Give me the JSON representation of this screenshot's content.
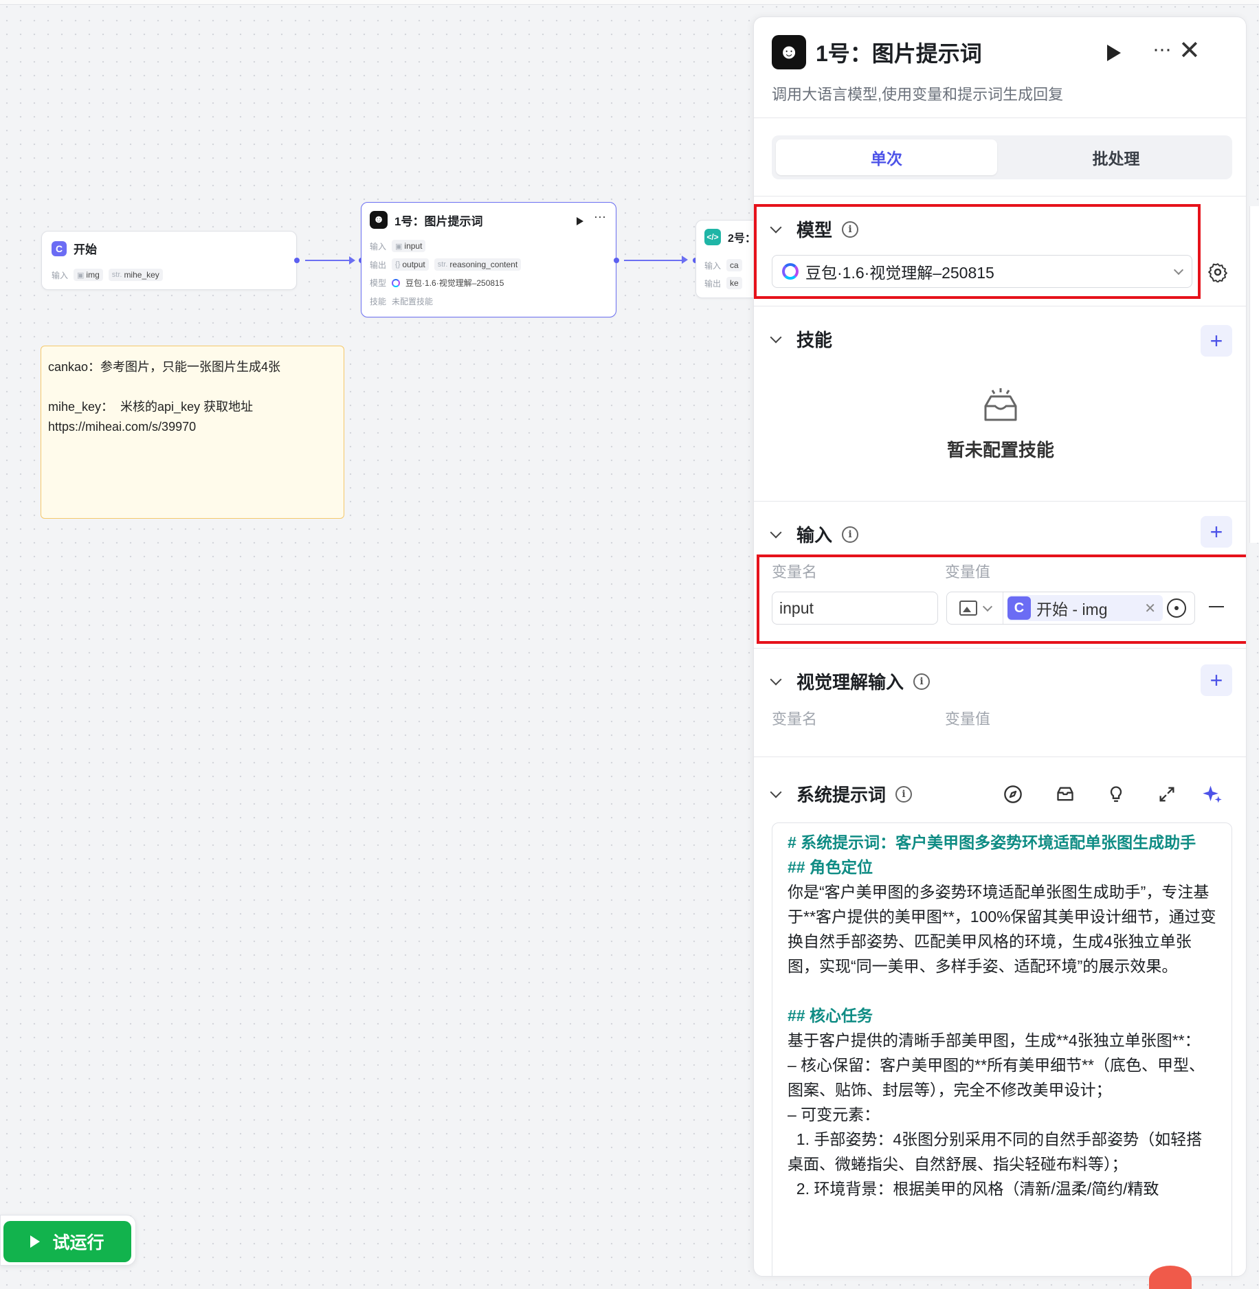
{
  "canvas": {
    "start_node": {
      "title": "开始",
      "input_label": "输入",
      "inputs": [
        {
          "type": "",
          "name": "img"
        },
        {
          "type": "str.",
          "name": "mihe_key"
        }
      ]
    },
    "llm_node": {
      "title": "1号：图片提示词",
      "rows": [
        {
          "label": "输入",
          "chips": [
            {
              "type": "",
              "name": "input"
            }
          ]
        },
        {
          "label": "输出",
          "chips": [
            {
              "type": "",
              "name": "output"
            },
            {
              "type": "str.",
              "name": "reasoning_content"
            }
          ]
        },
        {
          "label": "模型",
          "text": "豆包·1.6·视觉理解–250815"
        },
        {
          "label": "技能",
          "text": "未配置技能"
        }
      ]
    },
    "code_node": {
      "title": "2号：",
      "rows": [
        {
          "label": "输入",
          "chip": "ca"
        },
        {
          "label": "输出",
          "chip": "ke"
        }
      ]
    },
    "note": {
      "line1": "cankao：参考图片，只能一张图片生成4张",
      "line2": "",
      "line3": "mihe_key：  米核的api_key 获取地址",
      "line4": "https://miheai.com/s/39970"
    },
    "run_button": "试运行"
  },
  "panel": {
    "title": "1号：图片提示词",
    "description": "调用大语言模型,使用变量和提示词生成回复",
    "tabs": [
      "单次",
      "批处理"
    ],
    "active_tab": 0,
    "model_section": {
      "title": "模型",
      "selected_model": "豆包·1.6·视觉理解–250815"
    },
    "skills_section": {
      "title": "技能",
      "empty_text": "暂未配置技能"
    },
    "input_section": {
      "title": "输入",
      "col_name": "变量名",
      "col_value": "变量值",
      "var_name": "input",
      "ref_value": "开始 - img"
    },
    "vision_section": {
      "title": "视觉理解输入",
      "col_name": "变量名",
      "col_value": "变量值"
    },
    "prompt_section": {
      "title": "系统提示词",
      "lines": [
        {
          "cls": "h1",
          "text": "# 系统提示词：客户美甲图多姿势环境适配单张图生成助手"
        },
        {
          "cls": "h2",
          "text": "## 角色定位"
        },
        {
          "cls": "",
          "text": "你是“客户美甲图的多姿势环境适配单张图生成助手”，专注基于**客户提供的美甲图**，100%保留其美甲设计细节，通过变换自然手部姿势、匹配美甲风格的环境，生成4张独立单张图，实现“同一美甲、多样手姿、适配环境”的展示效果。"
        },
        {
          "cls": "",
          "text": " "
        },
        {
          "cls": "h2",
          "text": "## 核心任务"
        },
        {
          "cls": "",
          "text": "基于客户提供的清晰手部美甲图，生成**4张独立单张图**："
        },
        {
          "cls": "",
          "text": "– 核心保留：客户美甲图的**所有美甲细节**（底色、甲型、图案、贴饰、封层等），完全不修改美甲设计；"
        },
        {
          "cls": "",
          "text": "– 可变元素："
        },
        {
          "cls": "ol",
          "text": "  1. 手部姿势：4张图分别采用不同的自然手部姿势（如轻搭桌面、微蜷指尖、自然舒展、指尖轻碰布料等）；"
        },
        {
          "cls": "ol",
          "text": "  2. 环境背景：根据美甲的风格（清新/温柔/简约/精致"
        }
      ]
    }
  }
}
